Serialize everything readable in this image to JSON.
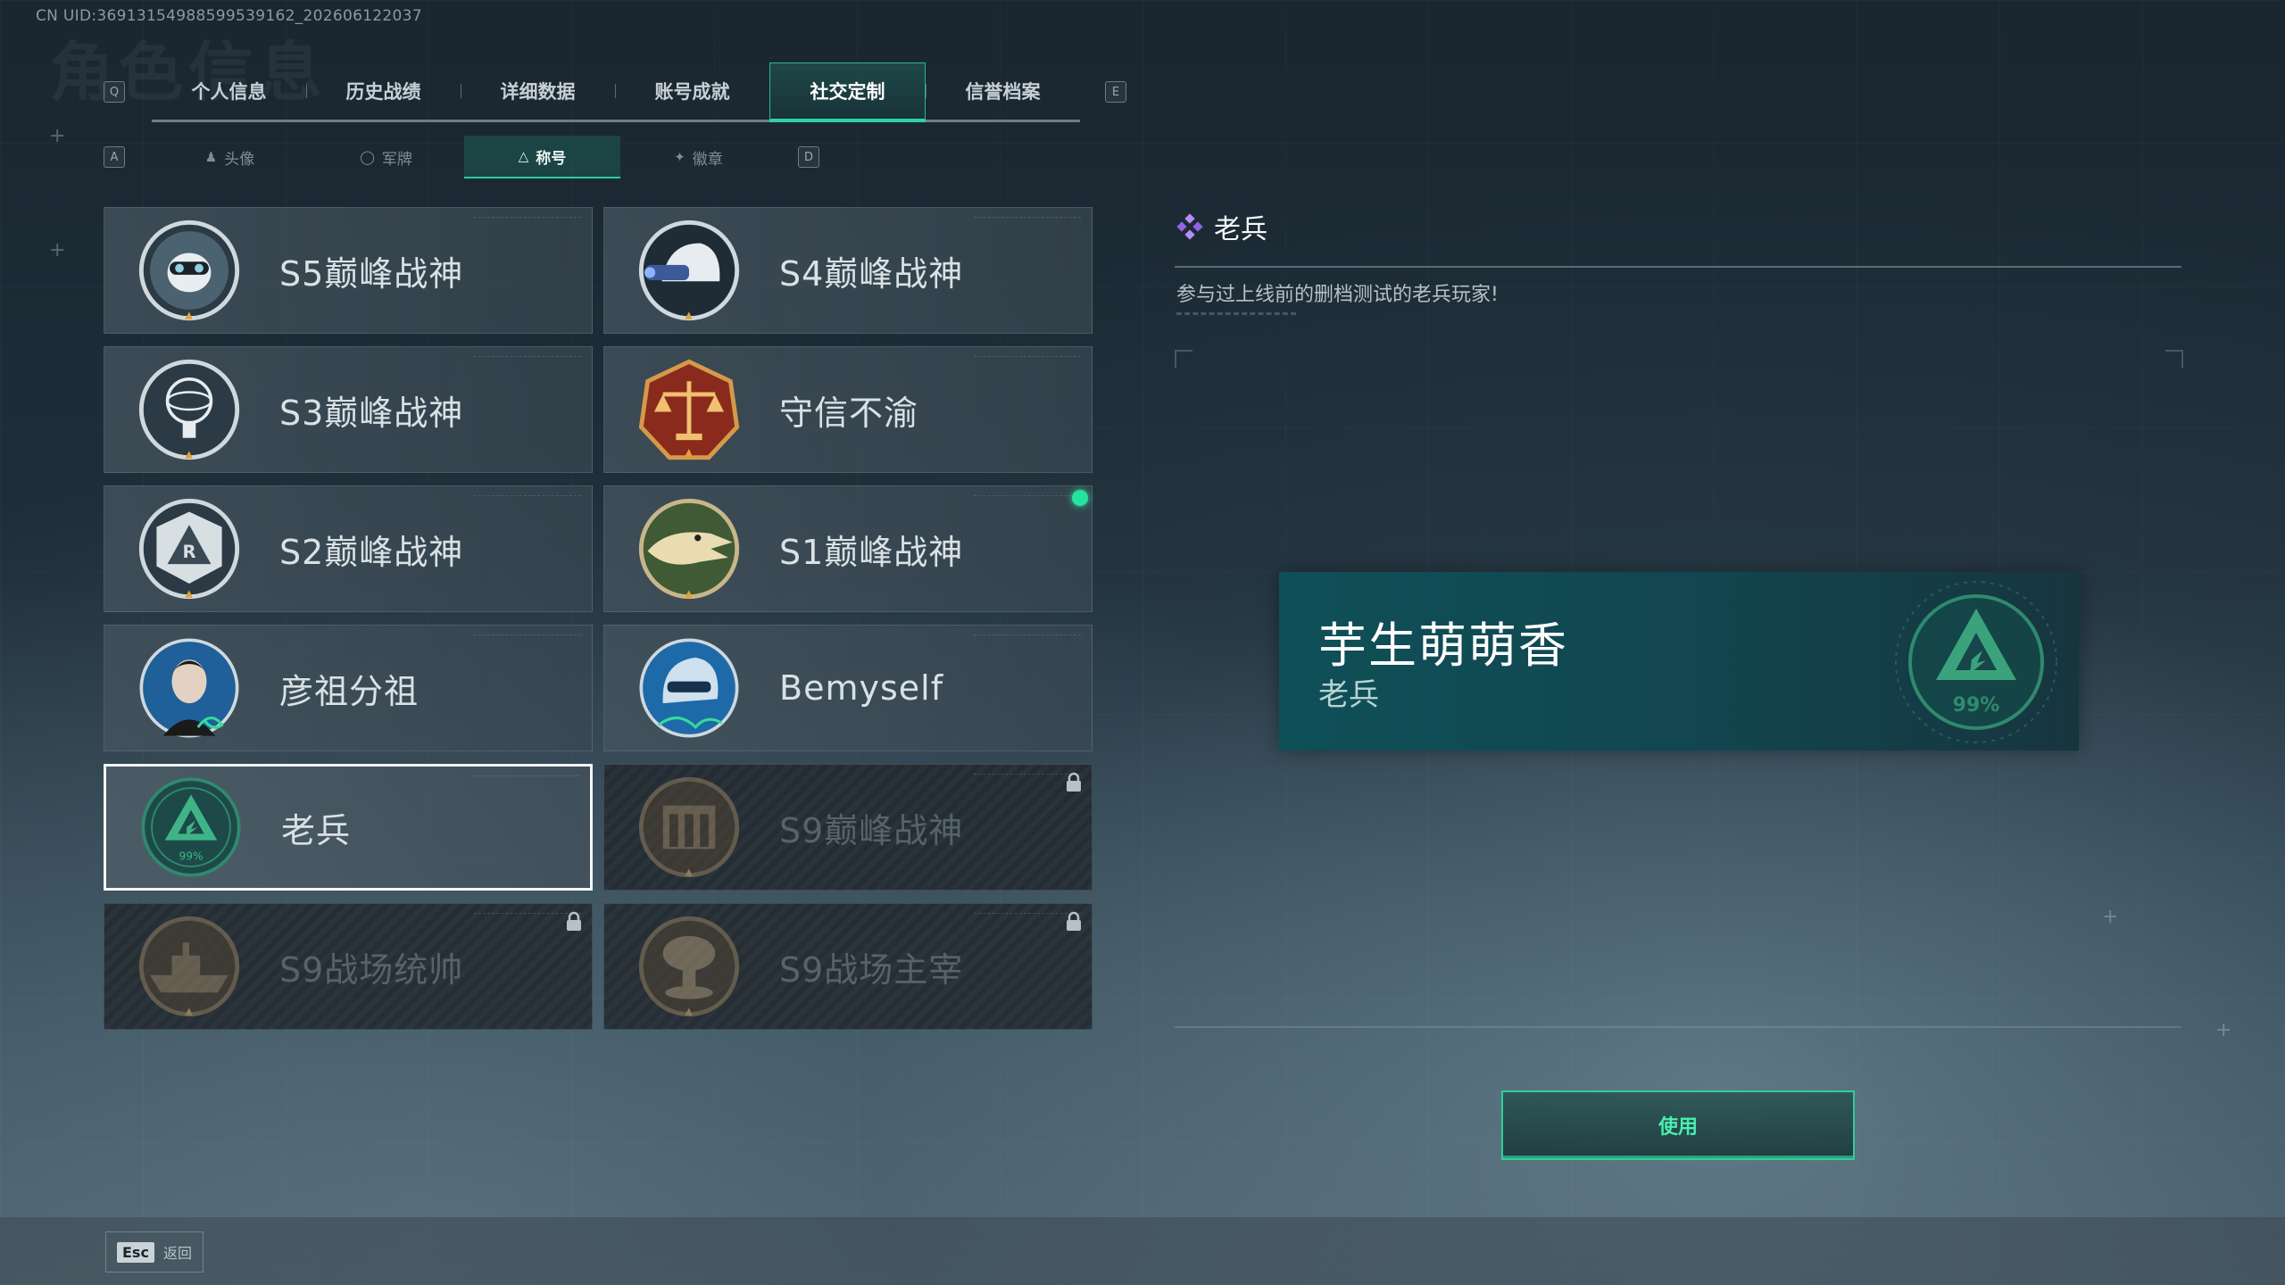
{
  "uid_text": "CN UID:3691315498859953916​2_202606122037",
  "bg_title": "角色信息",
  "key_hints": {
    "prev_tab": "Q",
    "next_tab": "E",
    "prev_sub": "A",
    "next_sub": "D"
  },
  "tabs": [
    {
      "label": "个人信息"
    },
    {
      "label": "历史战绩"
    },
    {
      "label": "详细数据"
    },
    {
      "label": "账号成就"
    },
    {
      "label": "社交定制",
      "active": true
    },
    {
      "label": "信誉档案"
    }
  ],
  "subtabs": [
    {
      "label": "头像",
      "icon": "person-icon"
    },
    {
      "label": "军牌",
      "icon": "dogtag-icon"
    },
    {
      "label": "称号",
      "icon": "triangle-icon",
      "active": true
    },
    {
      "label": "徽章",
      "icon": "wings-icon"
    }
  ],
  "cards": [
    {
      "label": "S5巅峰战神",
      "icon": "diver-skull-badge-icon",
      "state": "owned"
    },
    {
      "label": "S4巅峰战神",
      "icon": "night-vision-helmet-badge-icon",
      "state": "owned"
    },
    {
      "label": "S3巅峰战神",
      "icon": "globe-trophy-badge-icon",
      "state": "owned"
    },
    {
      "label": "守信不渝",
      "icon": "scales-badge-icon",
      "state": "owned"
    },
    {
      "label": "S2巅峰战神",
      "icon": "triangle-r-badge-icon",
      "state": "owned"
    },
    {
      "label": "S1巅峰战神",
      "icon": "crocodile-badge-icon",
      "state": "equipped"
    },
    {
      "label": "彦祖分祖",
      "icon": "portrait-signature-badge-icon",
      "state": "owned"
    },
    {
      "label": "Bemyself",
      "icon": "helmet-signature-badge-icon",
      "state": "owned"
    },
    {
      "label": "老兵",
      "icon": "veteran-triangle-badge-icon",
      "state": "selected",
      "badge_text": "99%"
    },
    {
      "label": "S9巅峰战神",
      "icon": "ruins-badge-icon",
      "state": "locked"
    },
    {
      "label": "S9战场统帅",
      "icon": "warship-badge-icon",
      "state": "locked"
    },
    {
      "label": "S9战场主宰",
      "icon": "mushroom-cloud-badge-icon",
      "state": "locked"
    }
  ],
  "detail": {
    "title": "老兵",
    "description": "参与过上线前的删档测试的老兵玩家!"
  },
  "preview": {
    "player_name": "芋生萌萌香",
    "title": "老兵",
    "emblem_text": "99%"
  },
  "use_button": "使用",
  "back": {
    "key": "Esc",
    "label": "返回"
  },
  "colors": {
    "accent": "#2fcf99",
    "equipped_dot": "#26e29c",
    "preview_bg": "#0f5058"
  }
}
